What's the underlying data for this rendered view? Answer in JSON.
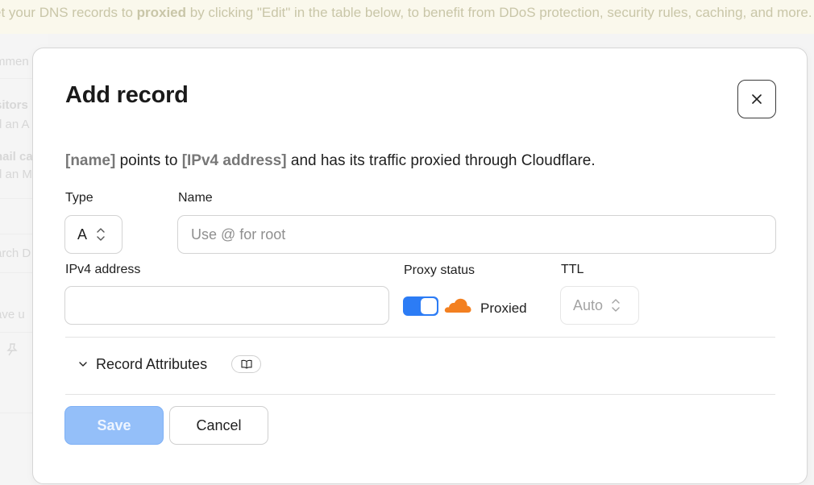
{
  "background": {
    "banner": {
      "prefix": "et your DNS records to ",
      "bold": "proxied",
      "suffix": " by clicking \"Edit\" in the table below, to benefit from DDoS protection, security rules, caching, and more."
    },
    "side_fragments": [
      "mmen",
      "sitors",
      "d an A",
      "nail ca",
      "d an M",
      "arch D",
      "ave u"
    ]
  },
  "modal": {
    "title": "Add record",
    "description": {
      "name_placeholder": "[name]",
      "part1": " points to ",
      "ip_placeholder": "[IPv4 address]",
      "part2": " and has its traffic proxied through Cloudflare."
    },
    "type": {
      "label": "Type",
      "value": "A"
    },
    "name": {
      "label": "Name",
      "placeholder": "Use @ for root"
    },
    "ipv4": {
      "label": "IPv4 address",
      "value": ""
    },
    "proxy": {
      "label": "Proxy status",
      "status_text": "Proxied",
      "enabled": true
    },
    "ttl": {
      "label": "TTL",
      "value": "Auto"
    },
    "record_attributes": {
      "label": "Record Attributes"
    },
    "buttons": {
      "save": "Save",
      "cancel": "Cancel"
    }
  },
  "colors": {
    "toggle_on": "#2c7cf5",
    "cloud": "#f38020",
    "save_disabled": "#94bff9"
  },
  "icons": {
    "close": "close-icon",
    "chevron_updown": "chevron-updown-icon",
    "chevron_down": "chevron-down-icon",
    "cloud": "cloud-icon",
    "book": "book-icon",
    "pin": "pin-icon"
  }
}
